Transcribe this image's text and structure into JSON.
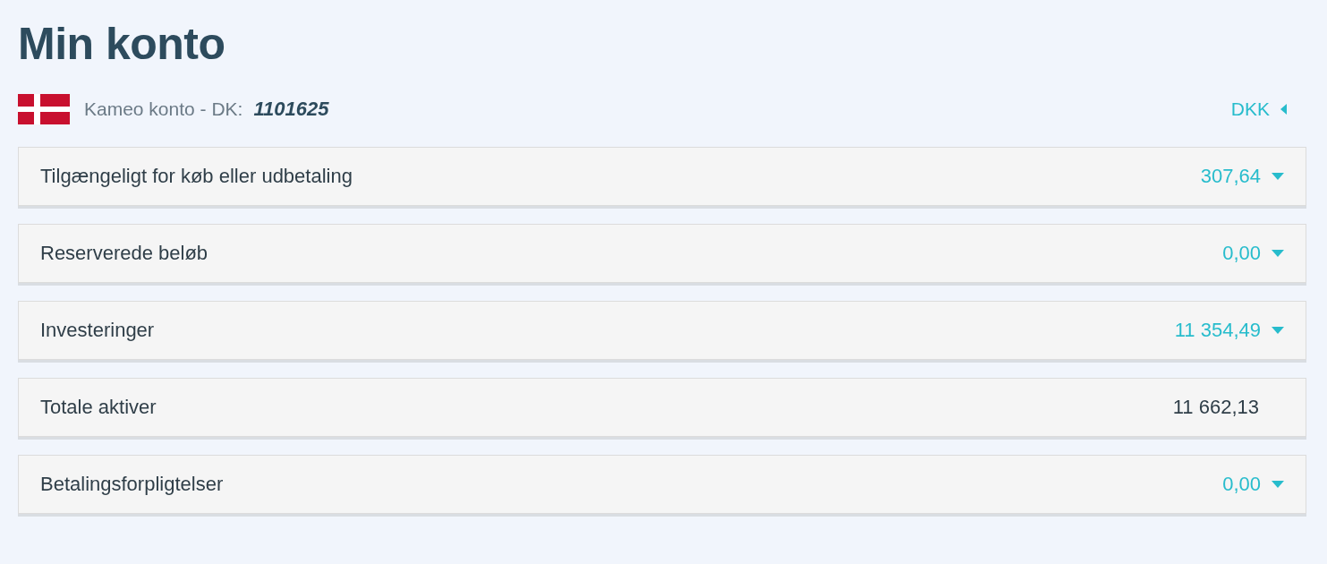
{
  "title": "Min konto",
  "account": {
    "label": "Kameo konto - DK:",
    "number": "1101625",
    "currency": "DKK"
  },
  "rows": [
    {
      "label": "Tilgængeligt for køb eller udbetaling",
      "value": "307,64",
      "expandable": true
    },
    {
      "label": "Reserverede beløb",
      "value": "0,00",
      "expandable": true
    },
    {
      "label": "Investeringer",
      "value": "11 354,49",
      "expandable": true
    },
    {
      "label": "Totale aktiver",
      "value": "11 662,13",
      "expandable": false
    },
    {
      "label": "Betalingsforpligtelser",
      "value": "0,00",
      "expandable": true
    }
  ]
}
